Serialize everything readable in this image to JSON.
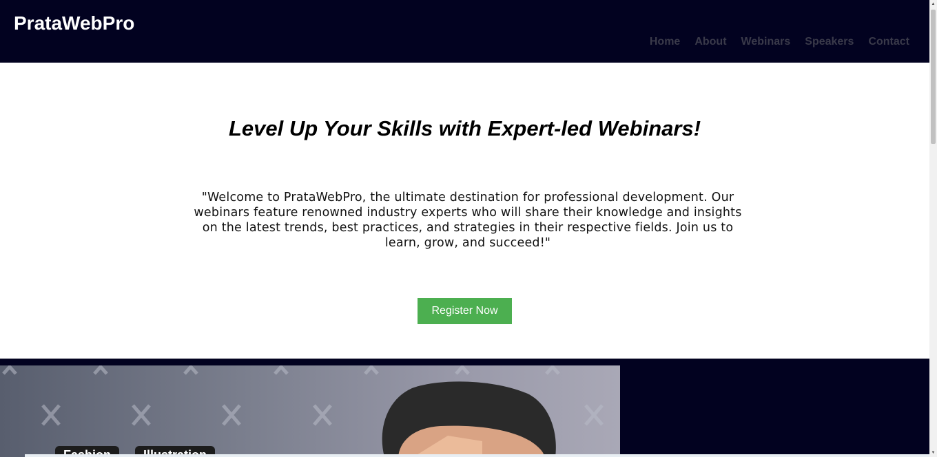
{
  "header": {
    "brand": "PrataWebPro",
    "nav": [
      "Home",
      "About",
      "Webinars",
      "Speakers",
      "Contact"
    ]
  },
  "hero": {
    "title": "Level Up Your Skills with Expert-led Webinars!",
    "description": "\"Welcome to PrataWebPro, the ultimate destination for professional development. Our webinars feature renowned industry experts who will share their knowledge and insights on the latest trends, best practices, and strategies in their respective fields. Join us to learn, grow, and succeed!\"",
    "register_label": "Register Now"
  },
  "banner": {
    "tags": [
      "Fashion",
      "Illustration"
    ]
  },
  "colors": {
    "header_bg": "#020220",
    "button_bg": "#4caf50",
    "nav_text": "#3a3a4a"
  }
}
